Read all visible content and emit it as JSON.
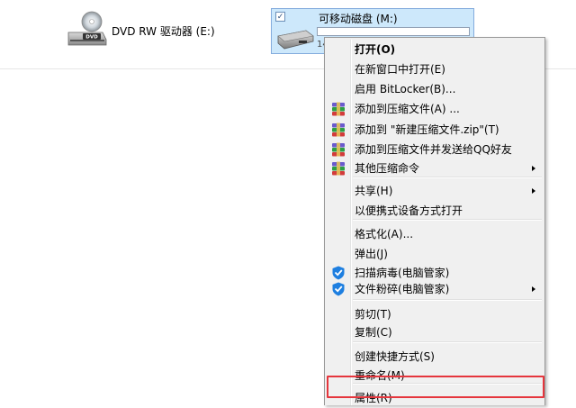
{
  "drives": {
    "dvd": {
      "label": "DVD RW 驱动器 (E:)",
      "icon": "dvd-drive-icon",
      "badge": "DVD"
    },
    "removable": {
      "title": "可移动磁盘 (M:)",
      "free_text": "14",
      "checked": true,
      "icon": "usb-drive-icon"
    }
  },
  "context_menu": {
    "items": [
      {
        "label": "打开(O)",
        "bold": true
      },
      {
        "label": "在新窗口中打开(E)"
      },
      {
        "label": "启用 BitLocker(B)..."
      },
      {
        "label": "添加到压缩文件(A) ...",
        "icon": "winrar-icon"
      },
      {
        "label": "添加到 \"新建压缩文件.zip\"(T)",
        "icon": "winrar-icon"
      },
      {
        "label": "添加到压缩文件并发送给QQ好友",
        "icon": "winrar-icon"
      },
      {
        "label": "其他压缩命令",
        "icon": "winrar-icon",
        "submenu": true
      },
      {
        "label": "共享(H)",
        "submenu": true
      },
      {
        "label": "以便携式设备方式打开"
      },
      {
        "label": "格式化(A)..."
      },
      {
        "label": "弹出(J)"
      },
      {
        "label": "扫描病毒(电脑管家)",
        "icon": "qq-pc-manager-icon"
      },
      {
        "label": "文件粉碎(电脑管家)",
        "icon": "qq-pc-manager-icon",
        "submenu": true
      },
      {
        "label": "剪切(T)"
      },
      {
        "label": "复制(C)"
      },
      {
        "label": "创建快捷方式(S)"
      },
      {
        "label": "重命名(M)"
      },
      {
        "label": "属性(R)",
        "highlighted": true
      }
    ]
  },
  "colors": {
    "selection_bg": "#cde8fb",
    "selection_border": "#84acdd",
    "highlight_border": "#e5363d",
    "menu_bg": "#f0f0f0"
  }
}
